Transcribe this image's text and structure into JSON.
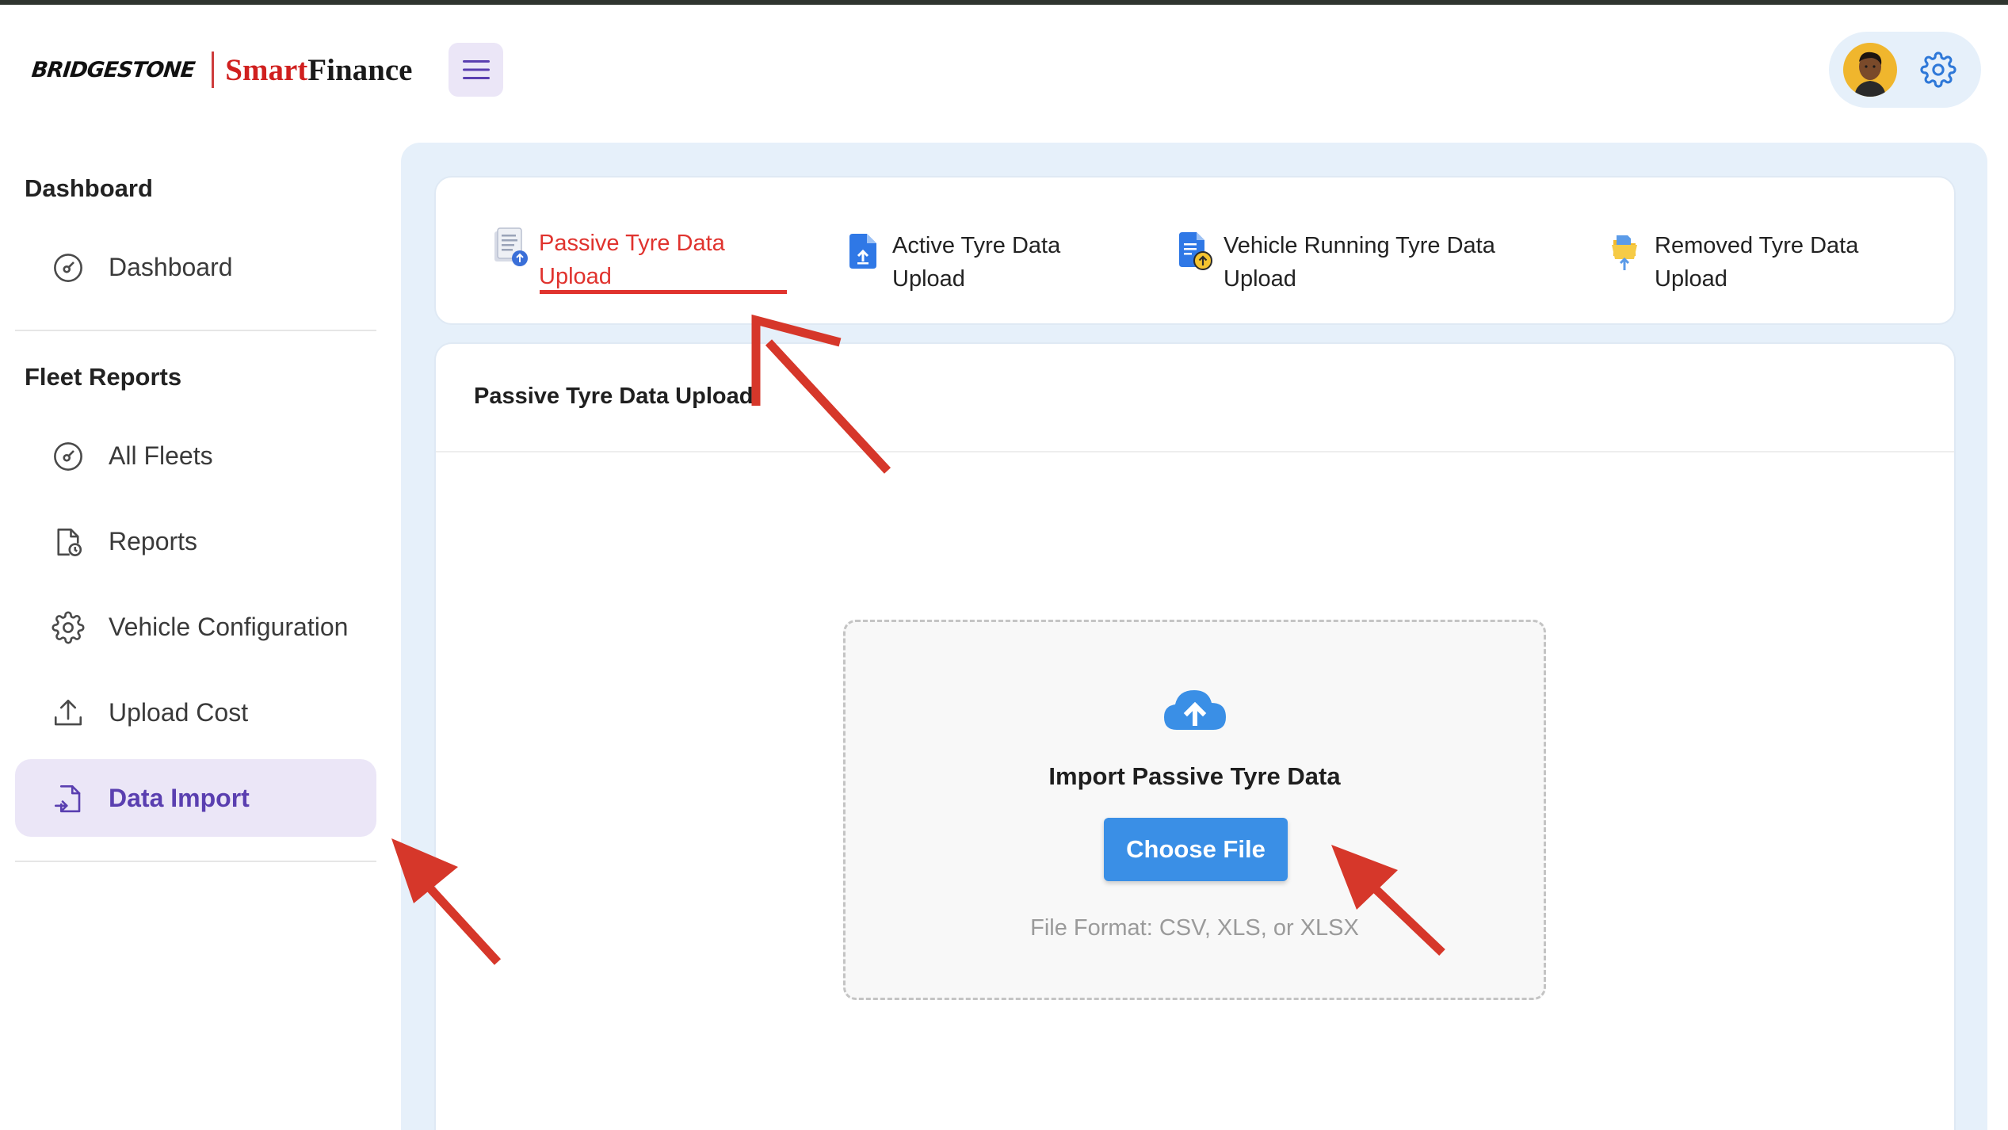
{
  "header": {
    "brand_name": "BRIDGESTONE",
    "product_name_part1": "Smart",
    "product_name_part2": "Finance",
    "menu_icon": "hamburger-menu-icon",
    "avatar_icon": "user-avatar",
    "settings_icon": "gear-icon"
  },
  "sidebar": {
    "sections": [
      {
        "title": "Dashboard"
      },
      {
        "title": "Fleet Reports"
      }
    ],
    "items": [
      {
        "label": "Dashboard",
        "icon": "gauge-icon",
        "active": false
      },
      {
        "label": "All Fleets",
        "icon": "gauge-icon",
        "active": false
      },
      {
        "label": "Reports",
        "icon": "report-clock-icon",
        "active": false
      },
      {
        "label": "Vehicle Configuration",
        "icon": "gear-icon",
        "active": false
      },
      {
        "label": "Upload Cost",
        "icon": "upload-icon",
        "active": false
      },
      {
        "label": "Data Import",
        "icon": "file-import-icon",
        "active": true
      }
    ]
  },
  "tabs": [
    {
      "label_line1": "Passive Tyre Data",
      "label_line2": "Upload",
      "icon": "passive-document-icon",
      "active": true
    },
    {
      "label_line1": "Active Tyre Data",
      "label_line2": "Upload",
      "icon": "active-upload-file-icon",
      "active": false
    },
    {
      "label_line1": "Vehicle Running Tyre Data",
      "label_line2": "Upload",
      "icon": "running-file-upload-icon",
      "active": false
    },
    {
      "label_line1": "Removed Tyre Data",
      "label_line2": "Upload",
      "icon": "removed-folder-icon",
      "active": false
    }
  ],
  "content": {
    "title": "Passive Tyre Data Upload",
    "dropzone": {
      "icon": "cloud-upload-icon",
      "title": "Import Passive Tyre Data",
      "button_label": "Choose File",
      "hint": "File Format: CSV, XLS, or XLSX"
    }
  },
  "colors": {
    "accent_red": "#e0332e",
    "brand_purple": "#5a3fb0",
    "primary_blue": "#3a8fe6",
    "annotation_red": "#d6372a",
    "active_bg": "#ebe6f7",
    "main_bg": "#e6f0fa"
  }
}
